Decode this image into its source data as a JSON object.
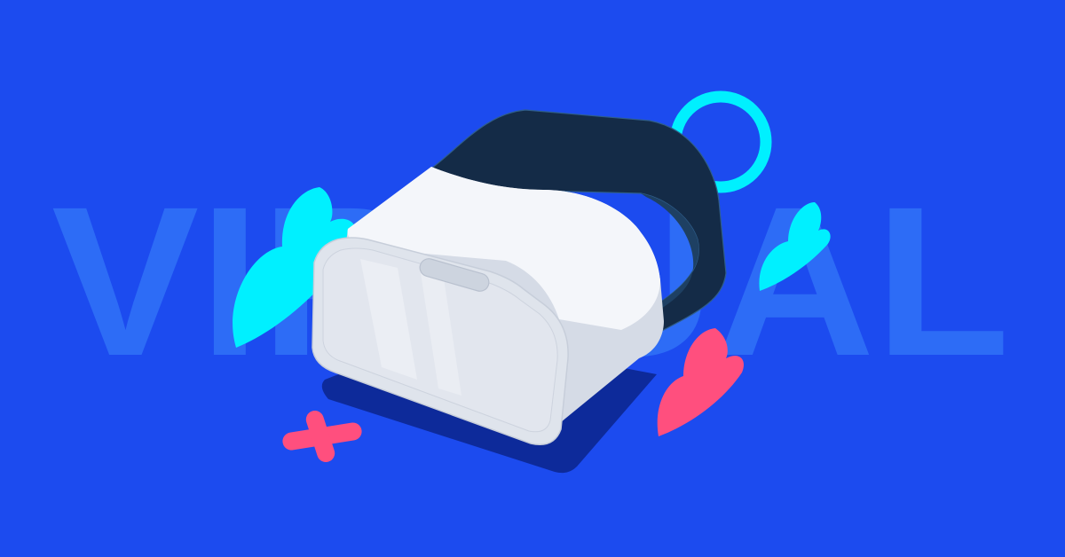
{
  "background": {
    "word": "VIRTUAL",
    "color": "#1c4bef",
    "word_color": "#2d6cf6"
  },
  "colors": {
    "headset_white": "#f4f6fa",
    "headset_shade": "#d5dbe6",
    "lens_panel": "#e2e6ee",
    "strap_dark": "#142b47",
    "strap_mid": "#1e4063",
    "shadow": "#0d2a9a",
    "cyan": "#00f0ff",
    "pink": "#ff4f7e"
  },
  "icons": [
    "vr-headset-icon",
    "ring-icon",
    "cloud-icon",
    "plus-icon"
  ]
}
